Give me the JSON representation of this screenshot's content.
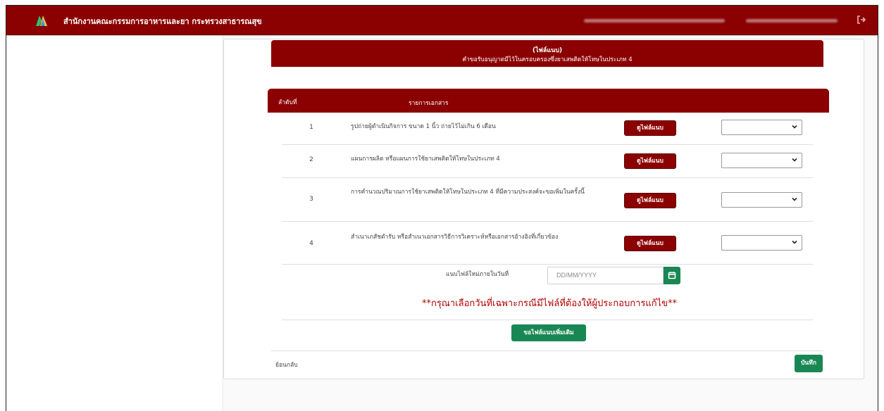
{
  "header": {
    "app_title": "สำนักงานคณะกรรมการอาหารและยา กระทรวงสาธารณสุข",
    "colors": {
      "brand": "#8b0000",
      "accent_green": "#198754"
    },
    "icons": {
      "logo": "fda-logo-icon",
      "logout": "logout-icon"
    }
  },
  "banner": {
    "line1": "(ไฟล์แนบ)",
    "line2": "คำขอรับอนุญาตมีไว้ในครอบครองซึ่งยาเสพติดให้โทษในประเภท 4"
  },
  "table": {
    "headers": {
      "seq": "ลำดับที่",
      "doc": "รายการเอกสาร"
    },
    "view_label": "ดูไฟล์แนบ",
    "rows": [
      {
        "num": "1",
        "doc": "รูปถ่ายผู้ดำเนินกิจการ ขนาด 1 นิ้ว ถ่ายไว้ไม่เกิน 6 เดือน",
        "status": ""
      },
      {
        "num": "2",
        "doc": "แผนการผลิต หรือแผนการใช้ยาเสพติดให้โทษในประเภท 4",
        "status": ""
      },
      {
        "num": "3",
        "doc": "การคำนวณปริมาณการใช้ยาเสพติดให้โทษในประเภท 4 ที่มีความประสงค์จะขอเพิ่มในครั้งนี้",
        "status": ""
      },
      {
        "num": "4",
        "doc": "สำเนาเภสัชตำรับ หรือสำเนาเอกสารวิธีการวิเคราะห์หรือเอกสารอ้างอิงที่เกี่ยวข้อง",
        "status": ""
      }
    ]
  },
  "date": {
    "label": "แนบไฟล์ใหม่ภายในวันที่",
    "placeholder": "DD/MM/YYYY",
    "icon": "calendar-icon"
  },
  "warning": "**กรุณาเลือกวันที่เฉพาะกรณีมีไฟล์ที่ต้องให้ผู้ประกอบการแก้ไข**",
  "actions": {
    "add_more": "ขอไฟล์แนบเพิ่มเติม",
    "back": "ย้อนกลับ",
    "save": "บันทึก"
  }
}
